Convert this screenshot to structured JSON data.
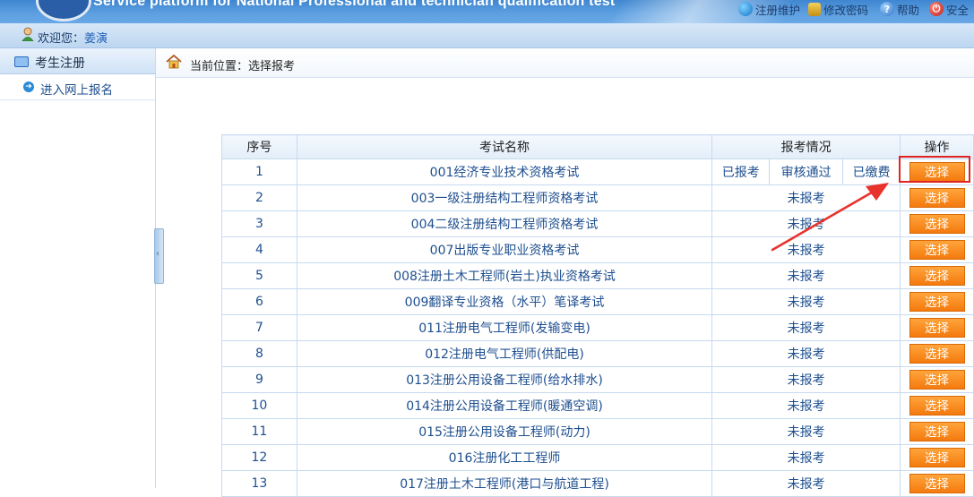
{
  "header": {
    "subtitle": "Service platform for National Professional and technician qualification test",
    "links": [
      {
        "label": "注册维护",
        "icon": "globe-icon"
      },
      {
        "label": "修改密码",
        "icon": "lock-icon"
      },
      {
        "label": "帮助",
        "icon": "help-icon"
      },
      {
        "label": "安全",
        "icon": "power-icon"
      }
    ]
  },
  "welcome": {
    "prefix": "欢迎您：",
    "user": "姜演"
  },
  "sidebar": {
    "section_title": "考生注册",
    "items": [
      {
        "label": "进入网上报名"
      }
    ]
  },
  "breadcrumb": {
    "text": "当前位置：选择报考"
  },
  "table": {
    "headers": {
      "index": "序号",
      "name": "考试名称",
      "status": "报考情况",
      "action": "操作"
    },
    "action_label": "选择",
    "rows": [
      {
        "index": "1",
        "name": "001经济专业技术资格考试",
        "status_parts": [
          "已报考",
          "审核通过",
          "已缴费"
        ]
      },
      {
        "index": "2",
        "name": "003一级注册结构工程师资格考试",
        "status": "未报考"
      },
      {
        "index": "3",
        "name": "004二级注册结构工程师资格考试",
        "status": "未报考"
      },
      {
        "index": "4",
        "name": "007出版专业职业资格考试",
        "status": "未报考"
      },
      {
        "index": "5",
        "name": "008注册土木工程师(岩土)执业资格考试",
        "status": "未报考"
      },
      {
        "index": "6",
        "name": "009翻译专业资格（水平）笔译考试",
        "status": "未报考"
      },
      {
        "index": "7",
        "name": "011注册电气工程师(发输变电)",
        "status": "未报考"
      },
      {
        "index": "8",
        "name": "012注册电气工程师(供配电)",
        "status": "未报考"
      },
      {
        "index": "9",
        "name": "013注册公用设备工程师(给水排水)",
        "status": "未报考"
      },
      {
        "index": "10",
        "name": "014注册公用设备工程师(暖通空调)",
        "status": "未报考"
      },
      {
        "index": "11",
        "name": "015注册公用设备工程师(动力)",
        "status": "未报考"
      },
      {
        "index": "12",
        "name": "016注册化工工程师",
        "status": "未报考"
      },
      {
        "index": "13",
        "name": "017注册土木工程师(港口与航道工程)",
        "status": "未报考"
      }
    ]
  },
  "colors": {
    "banner": "#4a8fd6",
    "link_text": "#1e4f8f",
    "select_button": "#f58a1f",
    "highlight": "#e02424"
  }
}
